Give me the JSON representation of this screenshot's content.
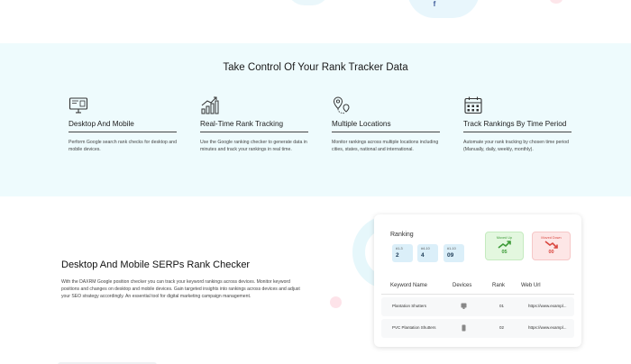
{
  "features_section": {
    "title": "Take Control Of Your Rank Tracker Data",
    "items": [
      {
        "icon": "desktop-icon",
        "title": "Desktop And Mobile",
        "description": "Perform Google search rank checks for desktop and mobile devices."
      },
      {
        "icon": "growth-chart-icon",
        "title": "Real-Time Rank Tracking",
        "description": "Use the Google ranking checker to generate data in minutes and track your rankings in real time."
      },
      {
        "icon": "location-pin-icon",
        "title": "Multiple Locations",
        "description": "Monitor rankings across multiple locations including cities, states, national and international."
      },
      {
        "icon": "calendar-icon",
        "title": "Track Rankings By Time Period",
        "description": "Automate your rank tracking by chosen time period (Manually, daily, weekly, monthly)."
      }
    ]
  },
  "serp_section": {
    "heading": "Desktop And Mobile SERPs Rank Checker",
    "paragraph": "With the DAXRM Google position checker you can track your keyword rankings across devices. Monitor keyword positions and changes on desktop and mobile devices. Gain targeted insights into rankings across devices and adjust your SEO strategy accordingly. An essential tool for digital marketing campaign management."
  },
  "ranking_card": {
    "title": "Ranking",
    "chips": [
      {
        "label": "#1-3",
        "value": "2"
      },
      {
        "label": "#4-10",
        "value": "4"
      },
      {
        "label": "#1-10",
        "value": "09"
      }
    ],
    "moved_up": {
      "label": "Moved Up",
      "value": "05"
    },
    "moved_down": {
      "label": "Moved Down",
      "value": "00"
    },
    "columns": [
      "Keyword Name",
      "Devices",
      "Rank",
      "Web Url"
    ],
    "rows": [
      {
        "keyword": "Plantation Shutters",
        "device": "desktop-icon",
        "rank": "01",
        "url": "https://www.exampl..."
      },
      {
        "keyword": "PVC Plantation Shutters",
        "device": "mobile-icon",
        "rank": "02",
        "url": "https://www.exampl..."
      }
    ]
  },
  "colors": {
    "features_bg": "#eefbfd",
    "chip_bg": "#dbeff9",
    "moved_up": "#3c9a37",
    "moved_down": "#d9463f",
    "facebook": "#3b5998"
  },
  "top_strip": {
    "social_icon": "facebook-icon",
    "glyph": "f"
  }
}
